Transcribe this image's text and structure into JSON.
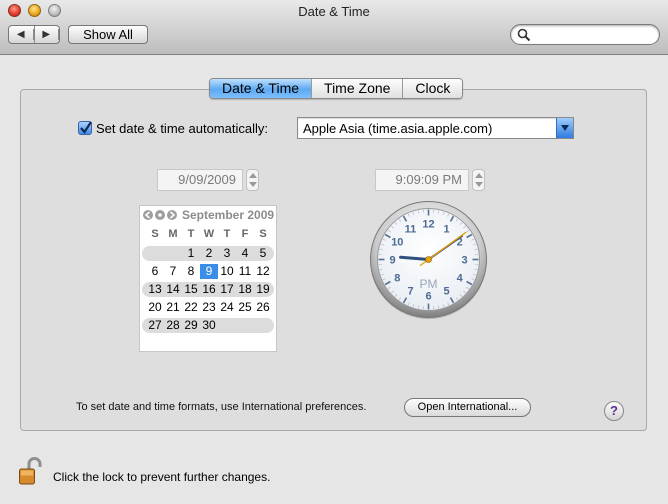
{
  "window": {
    "title": "Date & Time"
  },
  "toolbar": {
    "show_all_label": "Show All",
    "search_value": ""
  },
  "tabs": [
    {
      "label": "Date & Time",
      "selected": true
    },
    {
      "label": "Time Zone",
      "selected": false
    },
    {
      "label": "Clock",
      "selected": false
    }
  ],
  "auto": {
    "label": "Set date & time automatically:",
    "checked": true,
    "server": "Apple Asia (time.asia.apple.com)"
  },
  "date_field": {
    "value": "9/09/2009"
  },
  "time_field": {
    "value": "9:09:09  PM"
  },
  "calendar": {
    "month_label": "September 2009",
    "weekdays": [
      "S",
      "M",
      "T",
      "W",
      "T",
      "F",
      "S"
    ],
    "weeks": [
      [
        "",
        "",
        "1",
        "2",
        "3",
        "4",
        "5"
      ],
      [
        "6",
        "7",
        "8",
        "9",
        "10",
        "11",
        "12"
      ],
      [
        "13",
        "14",
        "15",
        "16",
        "17",
        "18",
        "19"
      ],
      [
        "20",
        "21",
        "22",
        "23",
        "24",
        "25",
        "26"
      ],
      [
        "27",
        "28",
        "29",
        "30",
        "",
        "",
        ""
      ]
    ],
    "selected_day": "9"
  },
  "clock": {
    "numerals": [
      "12",
      "1",
      "2",
      "3",
      "4",
      "5",
      "6",
      "7",
      "8",
      "9",
      "10",
      "11"
    ],
    "ampm": "PM",
    "hours": 9,
    "minutes": 9,
    "seconds": 9
  },
  "footer": {
    "formats_text": "To set date and time formats, use International preferences.",
    "open_international_label": "Open International...",
    "help_label": "?",
    "lock_text": "Click the lock to prevent further changes."
  },
  "colors": {
    "accent": "#3b8ee8",
    "tab_selected": "#5ea9f1",
    "second_hand": "#e8a100",
    "hand_blue": "#2f4f7f"
  }
}
